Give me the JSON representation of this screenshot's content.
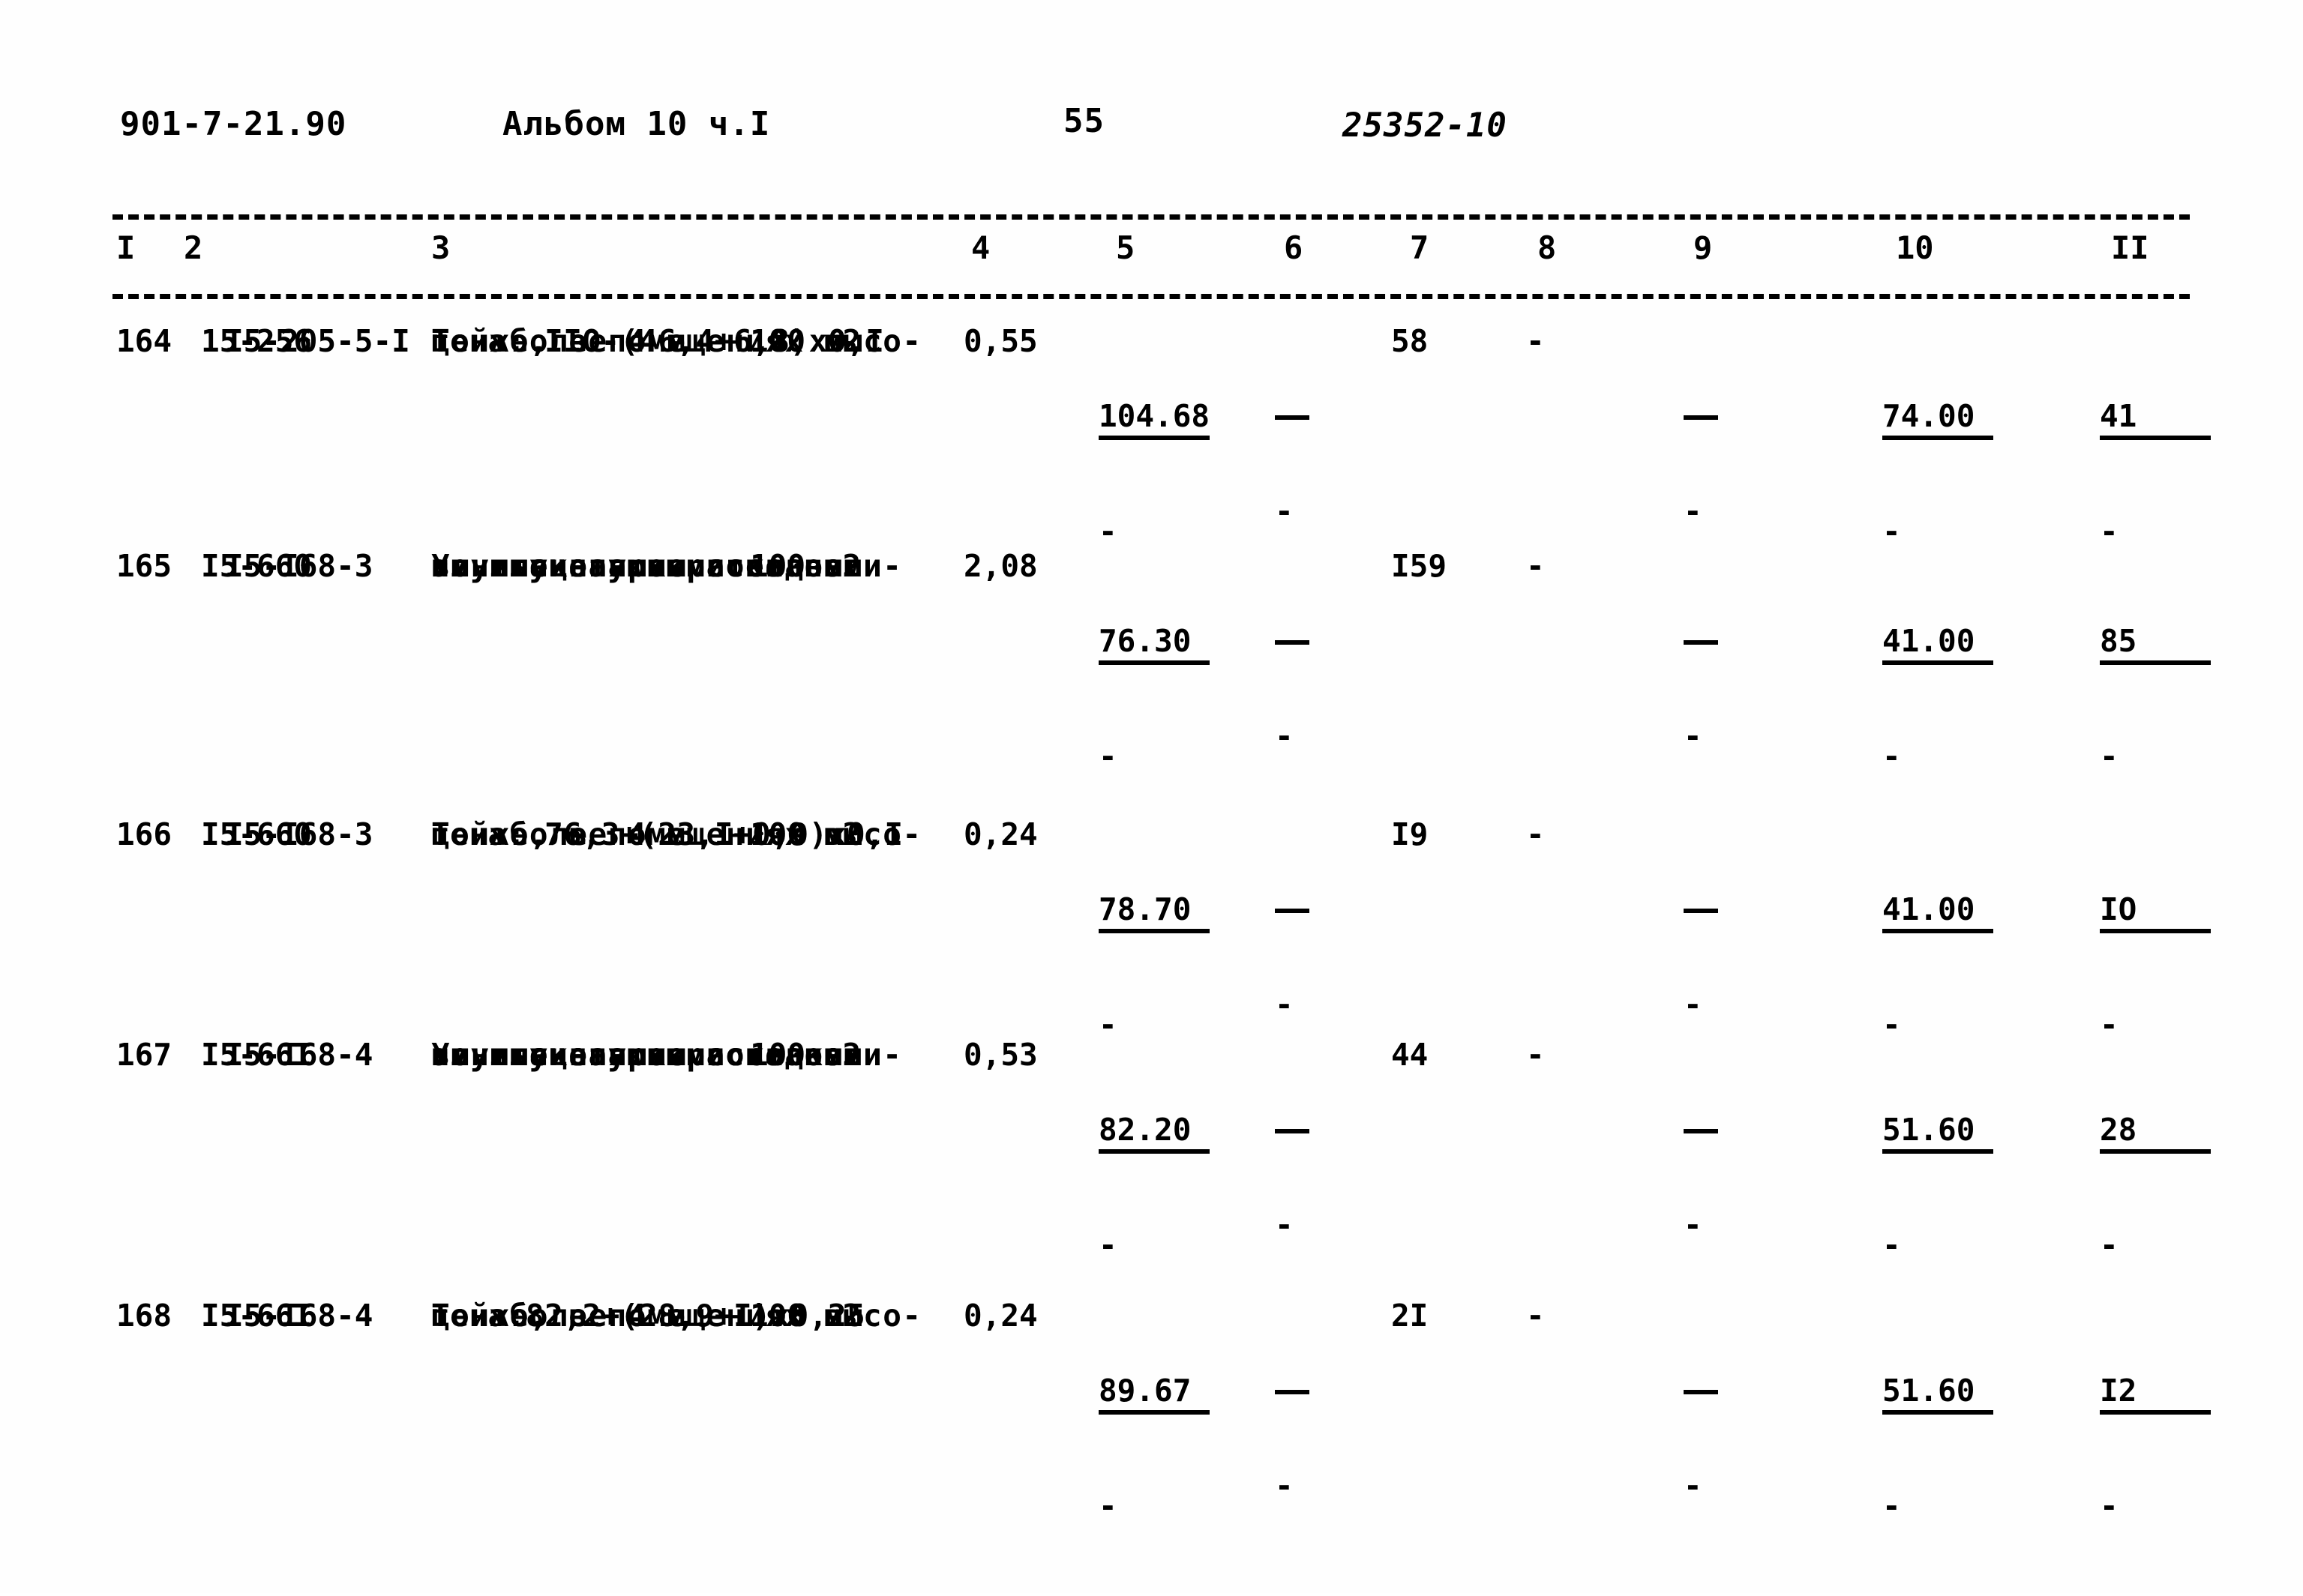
{
  "header": {
    "doc_code": "901-7-21.90",
    "album": "Альбом 10 ч.I",
    "page_number": "55",
    "stamp": "25352-10"
  },
  "table": {
    "column_headers": [
      "I",
      "2",
      "3",
      "4",
      "5",
      "6",
      "7",
      "8",
      "9",
      "10",
      "II"
    ],
    "rows": [
      {
        "num": "164",
        "code1": "15-256",
        "code2": "I5-205-5-I",
        "desc_lines": [
          "То же, в помещениях высо-",
          "той более 4 м"
        ],
        "unit": "100 м2",
        "price_note": "цена: IIO-(46,4+6,8)x0,I",
        "c4": "0,55",
        "c5_top": "104.68",
        "c5_bot": "-",
        "c6_bot": "-",
        "c7": "58",
        "c8": "-",
        "c9_bot": "-",
        "c10_top": "74.00",
        "c10_bot": "-",
        "c11_top": "41",
        "c11_bot": "-"
      },
      {
        "num": "165",
        "code1": "I5-660",
        "code2": "I5-I68-3",
        "desc_lines": [
          "Улучшенная окраска поли-",
          "винилацетатными водо-",
          "эмульсионными составами",
          "по штукатурке стен"
        ],
        "unit": "100 м2",
        "price_note": "",
        "c4": "2,08",
        "c5_top": "76.30",
        "c5_bot": "-",
        "c6_bot": "-",
        "c7": "I59",
        "c8": "-",
        "c9_bot": "-",
        "c10_top": "41.00",
        "c10_bot": "-",
        "c11_top": "85",
        "c11_bot": "-"
      },
      {
        "num": "166",
        "code1": "I5-660",
        "code2": "I5-I68-3",
        "desc_lines": [
          "То же, в помещениях высо-",
          "той более 4 м"
        ],
        "unit": "100 м2",
        "price_note": "цена: 76,3+(23,I+0,9)x0,I",
        "c4": "0,24",
        "c5_top": "78.70",
        "c5_bot": "-",
        "c6_bot": "-",
        "c7": "I9",
        "c8": "-",
        "c9_bot": "-",
        "c10_top": "41.00",
        "c10_bot": "-",
        "c11_top": "IO",
        "c11_bot": "-"
      },
      {
        "num": "167",
        "code1": "I5-66I",
        "code2": "I5-I68-4",
        "desc_lines": [
          "Улучшенная окраска поли-",
          "винилацетатными водо-",
          "эмульсионными составами",
          "по штукатурке потолков"
        ],
        "unit": "100 м2",
        "price_note": "",
        "c4": "0,53",
        "c5_top": "82.20",
        "c5_bot": "-",
        "c6_bot": "-",
        "c7": "44",
        "c8": "-",
        "c9_bot": "-",
        "c10_top": "51.60",
        "c10_bot": "-",
        "c11_top": "28",
        "c11_bot": "-"
      },
      {
        "num": "168",
        "code1": "I5-66I",
        "code2": "I5-I68-4",
        "desc_lines": [
          "То же, в помещениях высо-",
          "той более 4 м"
        ],
        "unit": "100 м2",
        "price_note": "цена:82,2+(28,9+I)x0,25",
        "c4": "0,24",
        "c5_top": "89.67",
        "c5_bot": "-",
        "c6_bot": "-",
        "c7": "2I",
        "c8": "-",
        "c9_bot": "-",
        "c10_top": "51.60",
        "c10_bot": "-",
        "c11_top": "I2",
        "c11_bot": "-"
      }
    ]
  }
}
